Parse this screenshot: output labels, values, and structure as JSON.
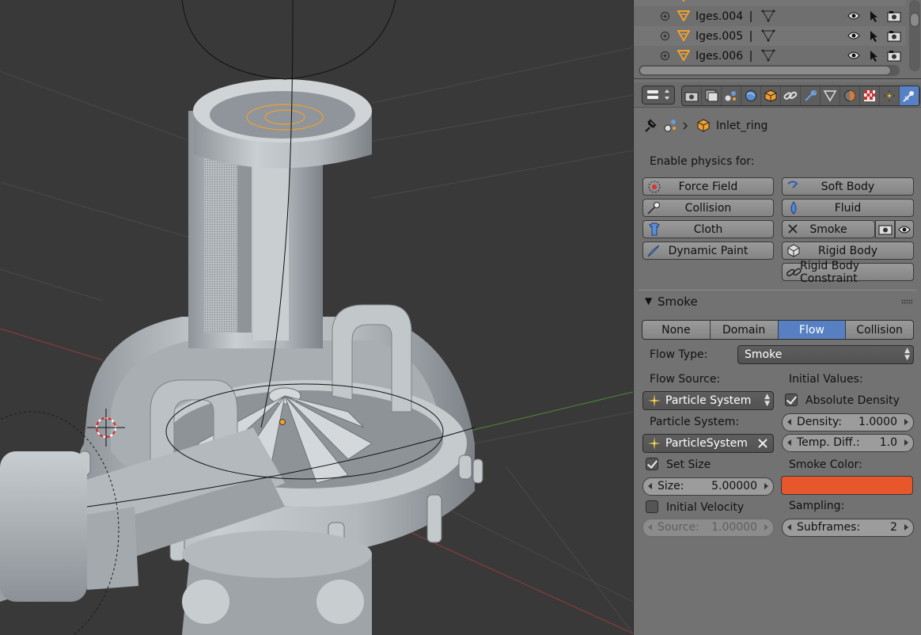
{
  "outliner": {
    "rows": [
      {
        "name": "Iges.004"
      },
      {
        "name": "Iges.005"
      },
      {
        "name": "Iges.006"
      }
    ]
  },
  "properties": {
    "breadcrumb": {
      "object_name": "Inlet_ring"
    },
    "enable_physics_label": "Enable physics for:",
    "physics_buttons": {
      "force_field": "Force Field",
      "soft_body": "Soft Body",
      "collision": "Collision",
      "fluid": "Fluid",
      "cloth": "Cloth",
      "smoke": "Smoke",
      "dynamic_paint": "Dynamic Paint",
      "rigid_body": "Rigid Body",
      "rigid_body_constraint": "Rigid Body Constraint"
    }
  },
  "smoke_panel": {
    "title": "Smoke",
    "types": [
      "None",
      "Domain",
      "Flow",
      "Collision"
    ],
    "active_type": "Flow",
    "flow_type_label": "Flow Type:",
    "flow_type_value": "Smoke",
    "flow_source_label": "Flow Source:",
    "flow_source_value": "Particle System",
    "initial_values_label": "Initial Values:",
    "absolute_density_label": "Absolute Density",
    "absolute_density_checked": true,
    "particle_system_label": "Particle System:",
    "particle_system_value": "ParticleSystem",
    "density_label": "Density:",
    "density_value": "1.0000",
    "temp_diff_label": "Temp. Diff.:",
    "temp_diff_value": "1.0",
    "set_size_label": "Set Size",
    "set_size_checked": true,
    "smoke_color_label": "Smoke Color:",
    "smoke_color": "#e8562b",
    "size_label": "Size:",
    "size_value": "5.00000",
    "initial_velocity_label": "Initial Velocity",
    "initial_velocity_checked": false,
    "sampling_label": "Sampling:",
    "source_label": "Source:",
    "source_value": "1.00000",
    "subframes_label": "Subframes:",
    "subframes_value": "2"
  },
  "colors": {
    "viewport_bg": "#393939",
    "panel_bg": "#727272",
    "accent_blue": "#5680c2",
    "selection_orange": "#f0a030"
  }
}
